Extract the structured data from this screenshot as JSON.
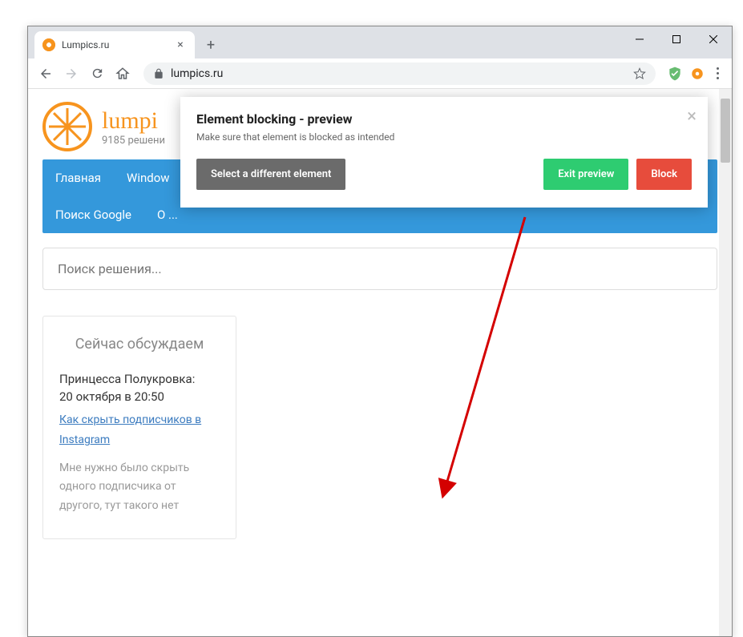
{
  "browser": {
    "tab_title": "Lumpics.ru",
    "url": "lumpics.ru"
  },
  "site": {
    "title": "lumpi",
    "subtitle": "9185 решени"
  },
  "nav": {
    "items": [
      "Главная",
      "Window",
      "Поиск Google",
      "О ..."
    ]
  },
  "search": {
    "placeholder": "Поиск решения..."
  },
  "sidebar": {
    "heading": "Сейчас обсуждаем",
    "comment": {
      "author": "Принцесса Полукровка:",
      "date": "20 октября в 20:50",
      "link": "Как скрыть подписчиков в Instagram",
      "text": "Мне нужно было скрыть одного подписчика от другого, тут такого нет"
    }
  },
  "dialog": {
    "title": "Element blocking - preview",
    "subtitle": "Make sure that element is blocked as intended",
    "select_btn": "Select a different element",
    "exit_btn": "Exit preview",
    "block_btn": "Block"
  }
}
